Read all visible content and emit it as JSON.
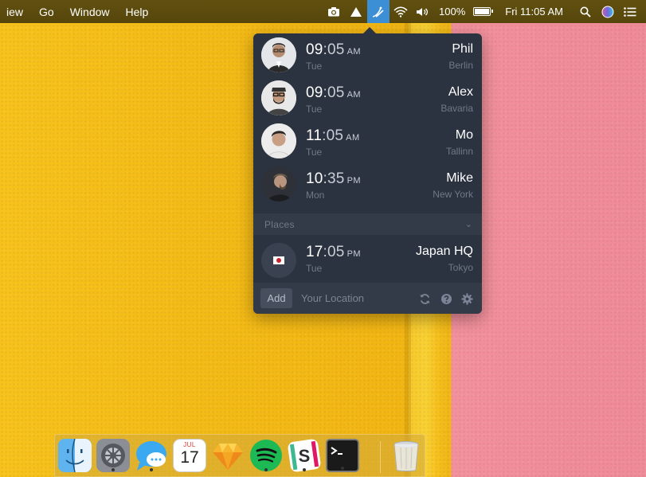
{
  "menubar": {
    "menus": [
      "iew",
      "Go",
      "Window",
      "Help"
    ],
    "battery_text": "100%",
    "battery_level": 1.0,
    "clock": "Fri 11:05 AM",
    "status_icons": [
      "camera-icon",
      "drive-icon",
      "timezone-app-icon",
      "wifi-icon",
      "volume-icon",
      "battery-icon",
      "spotlight-search-icon",
      "siri-icon",
      "notification-center-icon"
    ]
  },
  "people": [
    {
      "hours": "09",
      "minutes": ":05",
      "ampm": "AM",
      "day": "Tue",
      "name": "Phil",
      "city": "Berlin"
    },
    {
      "hours": "09",
      "minutes": ":05",
      "ampm": "AM",
      "day": "Tue",
      "name": "Alex",
      "city": "Bavaria"
    },
    {
      "hours": "11",
      "minutes": ":05",
      "ampm": "AM",
      "day": "Tue",
      "name": "Mo",
      "city": "Tallinn"
    },
    {
      "hours": "10",
      "minutes": ":35",
      "ampm": "PM",
      "day": "Mon",
      "name": "Mike",
      "city": "New York"
    }
  ],
  "places": {
    "section_label": "Places",
    "items": [
      {
        "hours": "17",
        "minutes": ":05",
        "ampm": "PM",
        "day": "Tue",
        "name": "Japan HQ",
        "city": "Tokyo",
        "flag": "japan-flag-icon"
      }
    ]
  },
  "footer": {
    "add_label": "Add",
    "location_placeholder": "Your Location"
  },
  "dock": {
    "apps": [
      "finder-icon",
      "system-preferences-icon",
      "messages-icon",
      "calendar-icon",
      "sketch-icon",
      "spotify-icon",
      "slack-icon",
      "terminal-icon",
      "trash-icon"
    ],
    "calendar_month": "JUL",
    "calendar_day": "17"
  }
}
